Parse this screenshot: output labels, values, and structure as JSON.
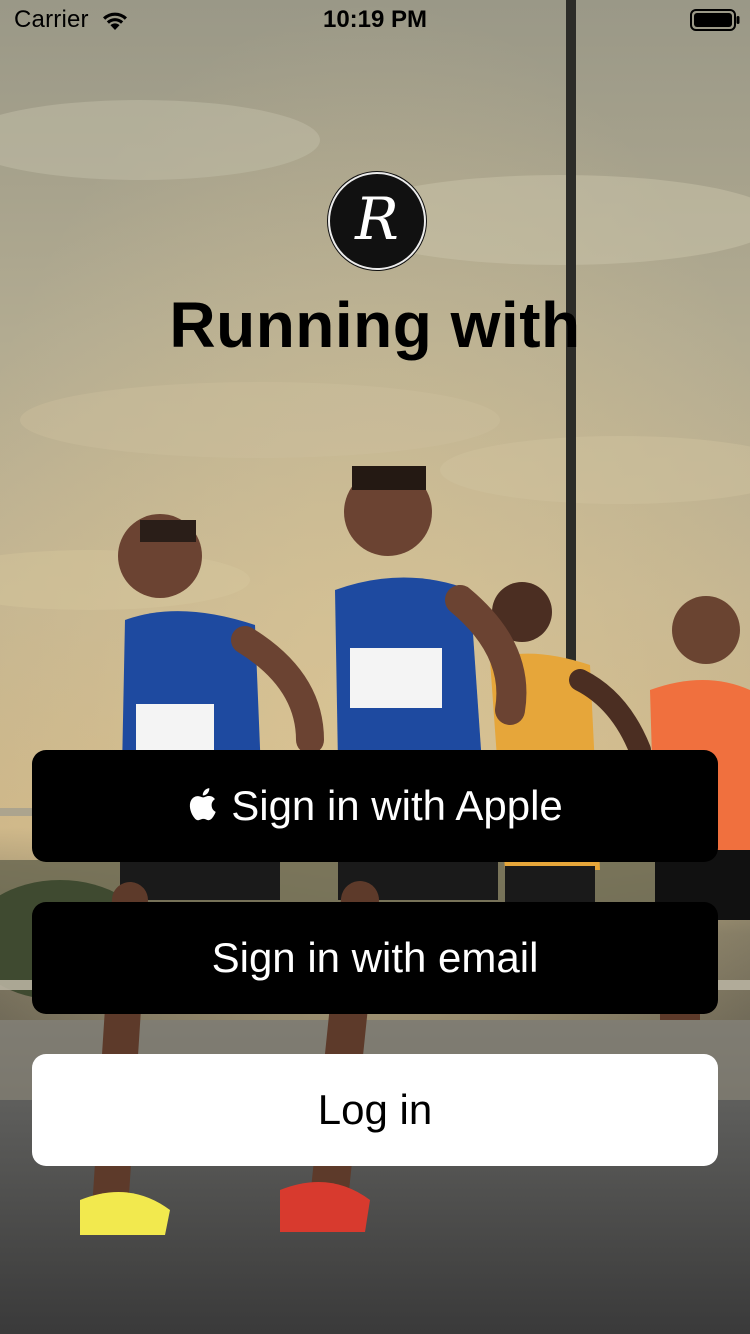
{
  "status_bar": {
    "carrier": "Carrier",
    "time": "10:19 PM",
    "icons": [
      "wifi-icon",
      "battery-icon"
    ]
  },
  "brand": {
    "logo_letter": "R",
    "title": "Running with"
  },
  "actions": {
    "apple_label": "Sign in with Apple",
    "apple_icon": "apple-icon",
    "email_label": "Sign in with email",
    "login_label": "Log in"
  },
  "colors": {
    "primary_button_bg": "#000000",
    "primary_button_text": "#ffffff",
    "secondary_button_bg": "#ffffff",
    "secondary_button_text": "#000000"
  }
}
